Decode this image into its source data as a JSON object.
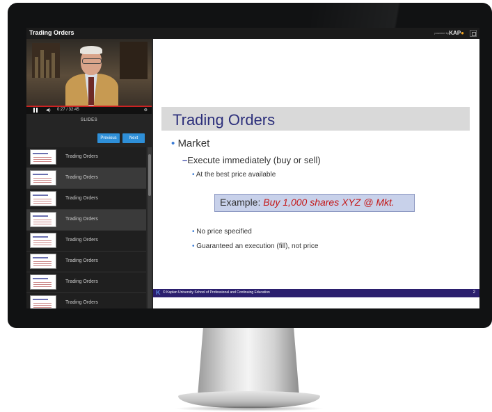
{
  "player": {
    "title": "Trading Orders",
    "powered_by": "powered by",
    "brand": "KAP",
    "brand_mark": "●",
    "time": "0:27 / 32:45",
    "video_progress_fraction": 0.014
  },
  "slides_panel": {
    "heading": "SLIDES",
    "previous_label": "Previous",
    "next_label": "Next",
    "items": [
      {
        "label": "Trading Orders"
      },
      {
        "label": "Trading Orders"
      },
      {
        "label": "Trading Orders"
      },
      {
        "label": "Trading Orders"
      },
      {
        "label": "Trading Orders"
      },
      {
        "label": "Trading Orders"
      },
      {
        "label": "Trading Orders"
      },
      {
        "label": "Trading Orders"
      }
    ]
  },
  "slide": {
    "title": "Trading Orders",
    "bullet1": "Market",
    "bullet2": "Execute immediately (buy or sell)",
    "bullet3": "At the best price available",
    "example_prefix": "Example: ",
    "example_text": "Buy 1,000 shares XYZ @ Mkt.",
    "bullet4": "No price specified",
    "bullet5": "Guaranteed an execution (fill), not price",
    "footer_text": "© Kaplan University School of Professional and Continuing Education",
    "page_number": "2"
  },
  "colors": {
    "accent_button": "#2e8fd8",
    "slide_title": "#2c2f7b",
    "example_highlight": "#c41818",
    "footer_bar": "#2b1f6e"
  }
}
